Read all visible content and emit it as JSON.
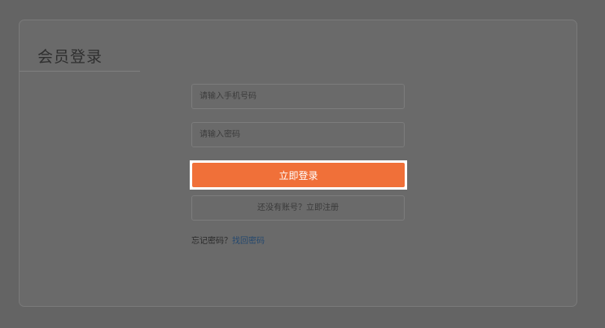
{
  "login_panel": {
    "title": "会员登录",
    "phone_placeholder": "请输入手机号码",
    "password_placeholder": "请输入密码",
    "login_button_label": "立即登录",
    "register_button_label": "还没有账号？立即注册",
    "forgot_prompt": "忘记密码？",
    "recover_link_label": "找回密码"
  },
  "colors": {
    "overlay_background": "#646464",
    "login_button": "#f07039",
    "link": "#24486e"
  }
}
